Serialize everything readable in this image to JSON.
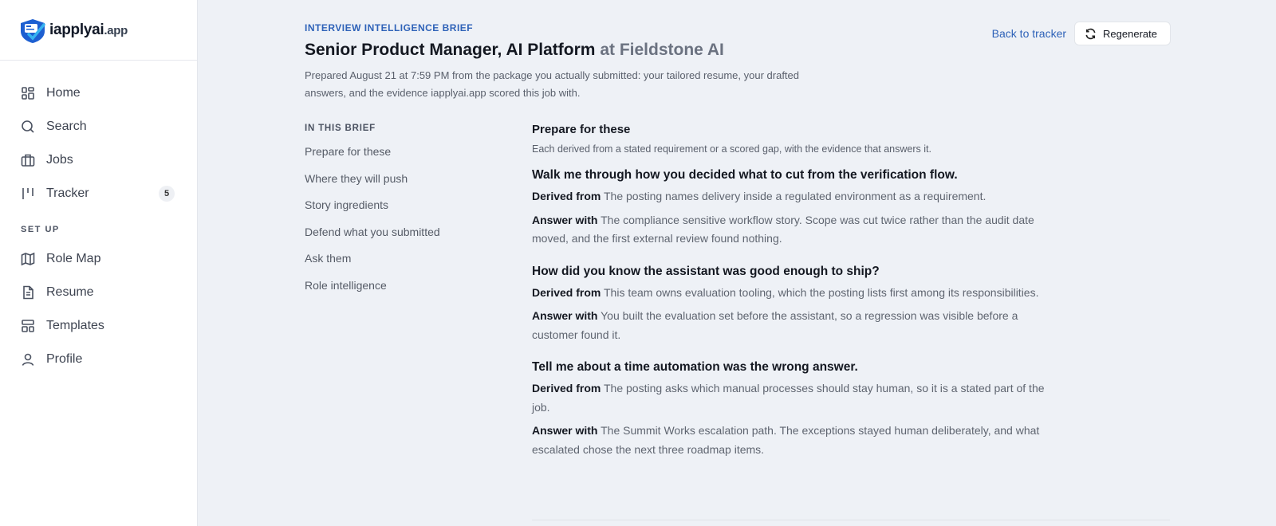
{
  "app": {
    "logo_name": "iapplyai",
    "logo_tld": ".app"
  },
  "sidebar": {
    "items": [
      {
        "label": "Home"
      },
      {
        "label": "Search"
      },
      {
        "label": "Jobs"
      },
      {
        "label": "Tracker",
        "badge": "5"
      }
    ],
    "setup_label": "SET UP",
    "setup_items": [
      {
        "label": "Role Map"
      },
      {
        "label": "Resume"
      },
      {
        "label": "Templates"
      },
      {
        "label": "Profile"
      }
    ]
  },
  "header": {
    "eyebrow": "INTERVIEW INTELLIGENCE BRIEF",
    "title": "Senior Product Manager, AI Platform",
    "company": "at Fieldstone AI",
    "subtitle": "Prepared August 21 at 7:59 PM from the package you actually submitted: your tailored resume, your drafted answers, and the evidence iapplyai.app scored this job with.",
    "back_label": "Back to tracker",
    "regenerate_label": "Regenerate"
  },
  "toc": {
    "label": "IN THIS BRIEF",
    "items": [
      "Prepare for these",
      "Where they will push",
      "Story ingredients",
      "Defend what you submitted",
      "Ask them",
      "Role intelligence"
    ]
  },
  "section": {
    "title": "Prepare for these",
    "description": "Each derived from a stated requirement or a scored gap, with the evidence that answers it.",
    "derived_label": "Derived from",
    "answer_label": "Answer with",
    "questions": [
      {
        "title": "Walk me through how you decided what to cut from the verification flow.",
        "derived": "The posting names delivery inside a regulated environment as a requirement.",
        "answer": "The compliance sensitive workflow story. Scope was cut twice rather than the audit date moved, and the first external review found nothing."
      },
      {
        "title": "How did you know the assistant was good enough to ship?",
        "derived": "This team owns evaluation tooling, which the posting lists first among its responsibilities.",
        "answer": "You built the evaluation set before the assistant, so a regression was visible before a customer found it."
      },
      {
        "title": "Tell me about a time automation was the wrong answer.",
        "derived": "The posting asks which manual processes should stay human, so it is a stated part of the job.",
        "answer": "The Summit Works escalation path. The exceptions stayed human deliberately, and what escalated chose the next three roadmap items."
      }
    ]
  },
  "colors": {
    "accent": "#2e62b8",
    "background": "#eef1f6",
    "sidebar": "#ffffff"
  }
}
